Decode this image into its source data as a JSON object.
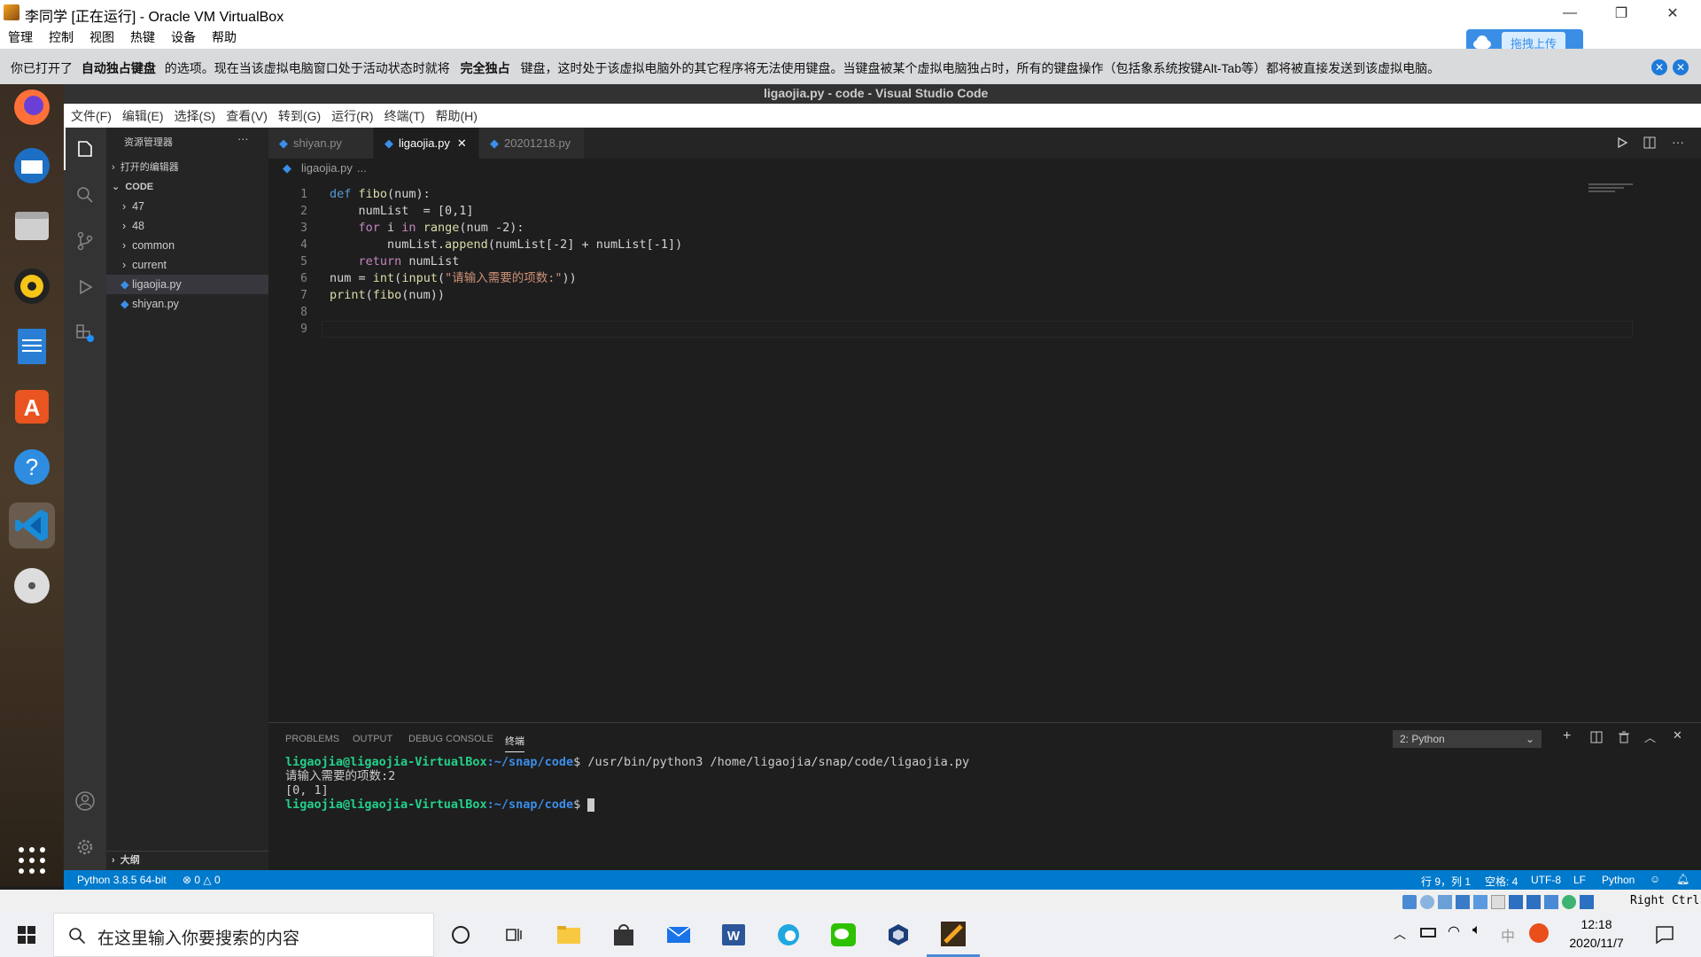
{
  "window": {
    "title": "李同学 [正在运行] - Oracle VM VirtualBox"
  },
  "vbox_menu": [
    "管理",
    "控制",
    "视图",
    "热键",
    "设备",
    "帮助"
  ],
  "notice": {
    "text_a": "你已打开了",
    "bold_a": "自动独占键盘",
    "text_b": "的选项。现在当该虚拟电脑窗口处于活动状态时就将",
    "bold_b": "完全独占",
    "text_c": "键盘，这时处于该虚拟电脑外的其它程序将无法使用键盘。当键盘被某个虚拟电脑独占时，所有的键盘操作（包括象系统按键Alt-Tab等）都将被直接发送到该虚拟电脑。",
    "upload_label": "拖拽上传"
  },
  "vscode": {
    "title": "ligaojia.py - code - Visual Studio Code",
    "menu": [
      "文件(F)",
      "编辑(E)",
      "选择(S)",
      "查看(V)",
      "转到(G)",
      "运行(R)",
      "终端(T)",
      "帮助(H)"
    ],
    "explorer": {
      "title": "资源管理器",
      "more": "···",
      "open_editors": "打开的编辑器",
      "folder": "CODE",
      "items": [
        "47",
        "48",
        "common",
        "current",
        "ligaojia.py",
        "shiyan.py"
      ],
      "outline": "大纲"
    },
    "tabs": [
      "shiyan.py",
      "ligaojia.py",
      "20201218.py"
    ],
    "breadcrumb": {
      "file": "ligaojia.py",
      "rest": "..."
    },
    "code": {
      "line_numbers": [
        "1",
        "2",
        "3",
        "4",
        "5",
        "6",
        "7",
        "8",
        "9"
      ],
      "l1_kw": "def",
      "l1_fn": "fibo",
      "l1_rest": "(num):",
      "l2": "    numList  = [0,1]",
      "l3_kw": "for",
      "l3_var": " i ",
      "l3_in": "in",
      "l3_fn": "range",
      "l3_rest": "(num -2):",
      "l4_a": "        numList.",
      "l4_fn": "append",
      "l4_rest": "(numList[-2] + numList[-1])",
      "l5_kw": "return",
      "l5_rest": " numList",
      "l6_a": "num = ",
      "l6_fn1": "int",
      "l6_b": "(",
      "l6_fn2": "input",
      "l6_c": "(",
      "l6_str": "\"请输入需要的项数:\"",
      "l6_d": "))",
      "l7_fn": "print",
      "l7_b": "(",
      "l7_fn2": "fibo",
      "l7_c": "(num))"
    },
    "panel": {
      "tabs": [
        "PROBLEMS",
        "OUTPUT",
        "DEBUG CONSOLE",
        "终端"
      ],
      "select": "2: Python",
      "user": "ligaojia@ligaojia-VirtualBox",
      "path": ":~/snap/code",
      "cmd": "$ /usr/bin/python3 /home/ligaojia/snap/code/ligaojia.py",
      "out1": "请输入需要的项数:2",
      "out2": "[0, 1]",
      "prompt_end": "$ "
    },
    "status": {
      "python": "Python 3.8.5 64-bit",
      "problems": "⊗ 0 △ 0",
      "pos": "行 9，列 1",
      "spaces": "空格: 4",
      "enc": "UTF-8",
      "eol": "LF",
      "lang": "Python"
    }
  },
  "vbox_status": {
    "host_key": "Right Ctrl"
  },
  "taskbar": {
    "search_placeholder": "在这里输入你要搜索的内容",
    "time": "12:18",
    "date": "2020/11/7",
    "ime": "中"
  }
}
